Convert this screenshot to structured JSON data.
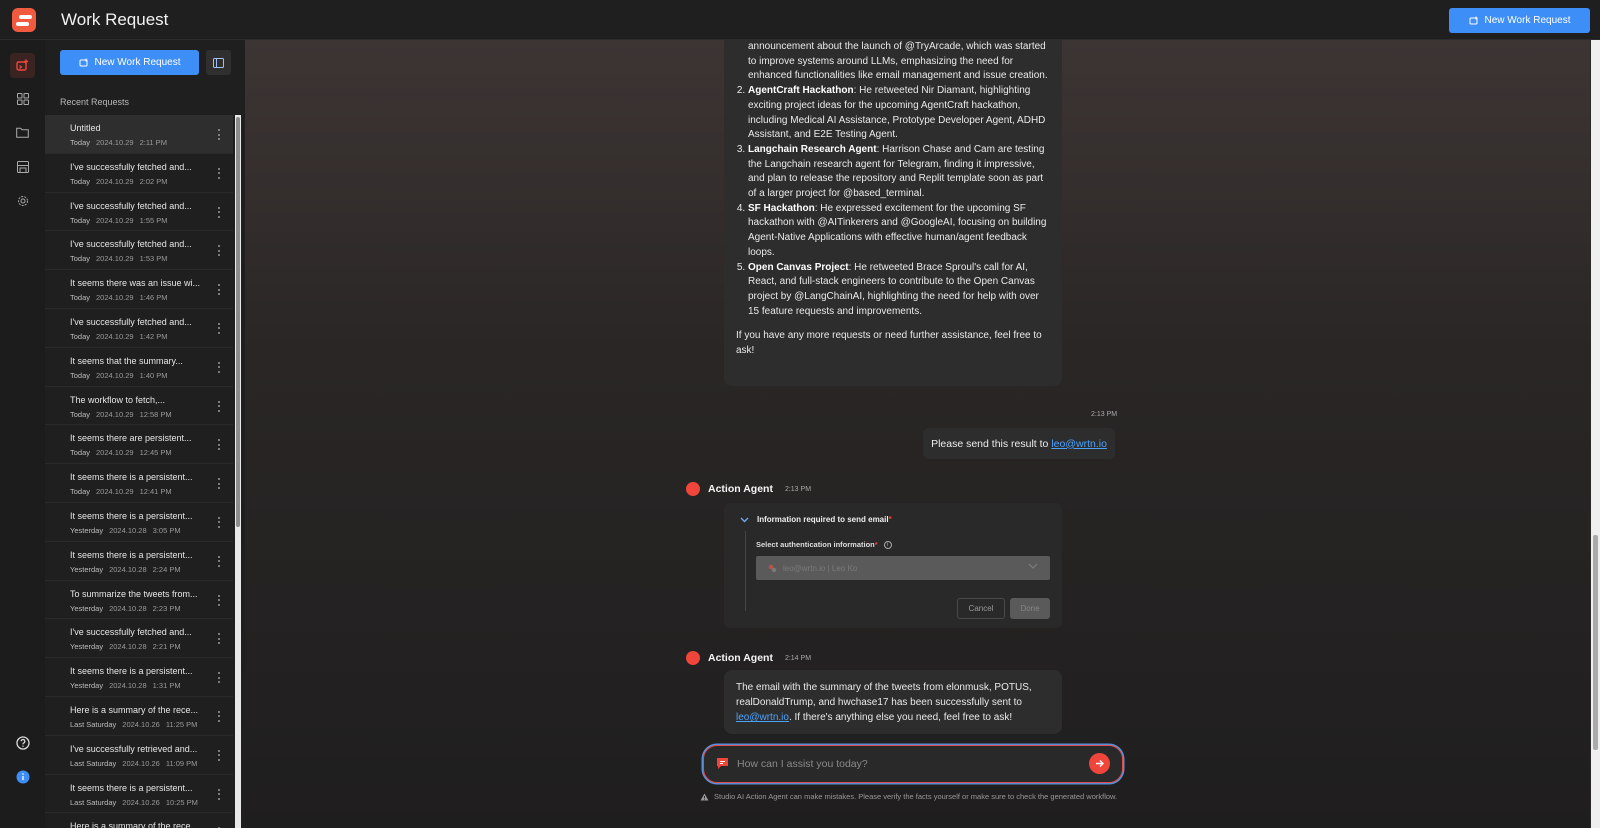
{
  "app": {
    "title": "Work Request"
  },
  "header": {
    "new_request_label": "New Work Request"
  },
  "rail": {
    "items": [
      {
        "name": "work-request-icon",
        "active": true
      },
      {
        "name": "grid-icon",
        "active": false
      },
      {
        "name": "folder-icon",
        "active": false
      },
      {
        "name": "store-icon",
        "active": false
      },
      {
        "name": "gear-icon",
        "active": false
      }
    ],
    "bottom": [
      {
        "name": "help-icon"
      },
      {
        "name": "info-icon"
      }
    ]
  },
  "sidebar": {
    "new_request_label": "New Work Request",
    "recent_label": "Recent Requests",
    "requests": [
      {
        "title": "Untitled",
        "day": "Today",
        "date": "2024.10.29",
        "time": "2:11 PM",
        "active": true
      },
      {
        "title": "I've successfully fetched and...",
        "day": "Today",
        "date": "2024.10.29",
        "time": "2:02 PM"
      },
      {
        "title": "I've successfully fetched and...",
        "day": "Today",
        "date": "2024.10.29",
        "time": "1:55 PM"
      },
      {
        "title": "I've successfully fetched and...",
        "day": "Today",
        "date": "2024.10.29",
        "time": "1:53 PM"
      },
      {
        "title": "It seems there was an issue wi...",
        "day": "Today",
        "date": "2024.10.29",
        "time": "1:46 PM"
      },
      {
        "title": "I've successfully fetched and...",
        "day": "Today",
        "date": "2024.10.29",
        "time": "1:42 PM"
      },
      {
        "title": "It seems that the summary...",
        "day": "Today",
        "date": "2024.10.29",
        "time": "1:40 PM"
      },
      {
        "title": "The workflow to fetch,...",
        "day": "Today",
        "date": "2024.10.29",
        "time": "12:58 PM"
      },
      {
        "title": "It seems there are persistent...",
        "day": "Today",
        "date": "2024.10.29",
        "time": "12:45 PM"
      },
      {
        "title": "It seems there is a persistent...",
        "day": "Today",
        "date": "2024.10.29",
        "time": "12:41 PM"
      },
      {
        "title": "It seems there is a persistent...",
        "day": "Yesterday",
        "date": "2024.10.28",
        "time": "3:05 PM"
      },
      {
        "title": "It seems there is a persistent...",
        "day": "Yesterday",
        "date": "2024.10.28",
        "time": "2:24 PM"
      },
      {
        "title": "To summarize the tweets from...",
        "day": "Yesterday",
        "date": "2024.10.28",
        "time": "2:23 PM"
      },
      {
        "title": "I've successfully fetched and...",
        "day": "Yesterday",
        "date": "2024.10.28",
        "time": "2:21 PM"
      },
      {
        "title": "It seems there is a persistent...",
        "day": "Yesterday",
        "date": "2024.10.28",
        "time": "1:31 PM"
      },
      {
        "title": "Here is a summary of the rece...",
        "day": "Last Saturday",
        "date": "2024.10.26",
        "time": "11:25 PM"
      },
      {
        "title": "I've successfully retrieved and...",
        "day": "Last Saturday",
        "date": "2024.10.26",
        "time": "11:09 PM"
      },
      {
        "title": "It seems there is a persistent...",
        "day": "Last Saturday",
        "date": "2024.10.26",
        "time": "10:25 PM"
      },
      {
        "title": "Here is a summary of the rece...",
        "day": "",
        "date": "",
        "time": ""
      }
    ]
  },
  "chat": {
    "message1": {
      "intro": "announcement about the launch of @TryArcade, which was started to improve systems around LLMs, emphasizing the need for enhanced functionalities like email management and issue creation.",
      "items": [
        {
          "title": "AgentCraft Hackathon",
          "text": ": He retweeted Nir Diamant, highlighting exciting project ideas for the upcoming AgentCraft hackathon, including Medical AI Assistance, Prototype Developer Agent, ADHD Assistant, and E2E Testing Agent."
        },
        {
          "title": "Langchain Research Agent",
          "text": ": Harrison Chase and Cam are testing the Langchain research agent for Telegram, finding it impressive, and plan to release the repository and Replit template soon as part of a larger project for @based_terminal."
        },
        {
          "title": "SF Hackathon",
          "text": ": He expressed excitement for the upcoming SF hackathon with @AITinkerers and @GoogleAI, focusing on building Agent-Native Applications with effective human/agent feedback loops."
        },
        {
          "title": "Open Canvas Project",
          "text": ": He retweeted Brace Sproul's call for AI, React, and full-stack engineers to contribute to the Open Canvas project by @LangChainAI, highlighting the need for help with over 15 feature requests and improvements."
        }
      ],
      "closing": "If you have any more requests or need further assistance, feel free to ask!"
    },
    "user_message": {
      "time": "2:13 PM",
      "text": "Please send this result to ",
      "link": "leo@wrtn.io"
    },
    "agent1": {
      "name": "Action Agent",
      "time": "2:13 PM",
      "form_title": "Information required to send email",
      "form_label": "Select authentication information",
      "select_value": "leo@wrtn.io | Leo Ko",
      "cancel_label": "Cancel",
      "done_label": "Done"
    },
    "agent2": {
      "name": "Action Agent",
      "time": "2:14 PM",
      "text_before": "The email with the summary of the tweets from elonmusk, POTUS, realDonaldTrump, and hwchase17 has been successfully sent to ",
      "link": "leo@wrtn.io",
      "text_after": ". If there's anything else you need, feel free to ask!"
    },
    "input": {
      "placeholder": "How can I assist you today?",
      "value": ""
    },
    "disclaimer": "Studio AI Action Agent can make mistakes. Please verify the facts yourself or make sure to check the generated workflow."
  },
  "colors": {
    "accent": "#3e8ef7",
    "brand": "#f05a3f",
    "agent": "#f0453a",
    "link": "#4aa3ff"
  }
}
